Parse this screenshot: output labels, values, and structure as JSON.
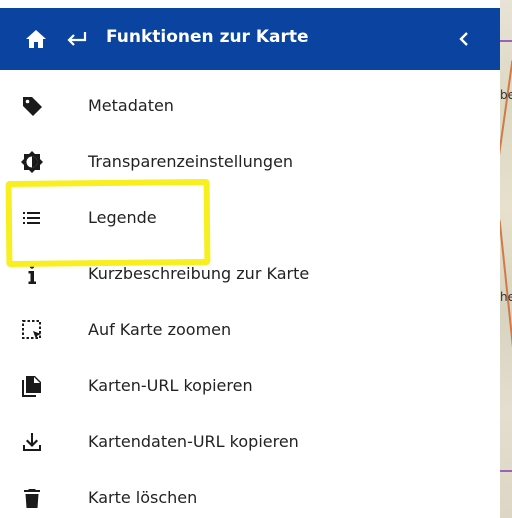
{
  "header": {
    "title": "Funktionen zur Karte",
    "home_icon": "home-icon",
    "back_icon": "arrow-back-icon",
    "collapse_icon": "chevron-left-icon"
  },
  "menu": {
    "items": [
      {
        "label": "Metadaten",
        "icon": "tag-icon"
      },
      {
        "label": "Transparenzeinstellungen",
        "icon": "contrast-icon"
      },
      {
        "label": "Legende",
        "icon": "list-icon"
      },
      {
        "label": "Kurzbeschreibung zur Karte",
        "icon": "info-icon"
      },
      {
        "label": "Auf Karte zoomen",
        "icon": "zoom-extent-icon"
      },
      {
        "label": "Karten-URL kopieren",
        "icon": "copy-icon"
      },
      {
        "label": "Kartendaten-URL kopieren",
        "icon": "download-icon"
      },
      {
        "label": "Karte löschen",
        "icon": "trash-icon"
      }
    ]
  },
  "map_strip": {
    "labels": [
      "be",
      "he"
    ]
  },
  "colors": {
    "header_bg": "#0b44a0",
    "highlight": "#f7ef20",
    "icon": "#1a1a1a"
  }
}
